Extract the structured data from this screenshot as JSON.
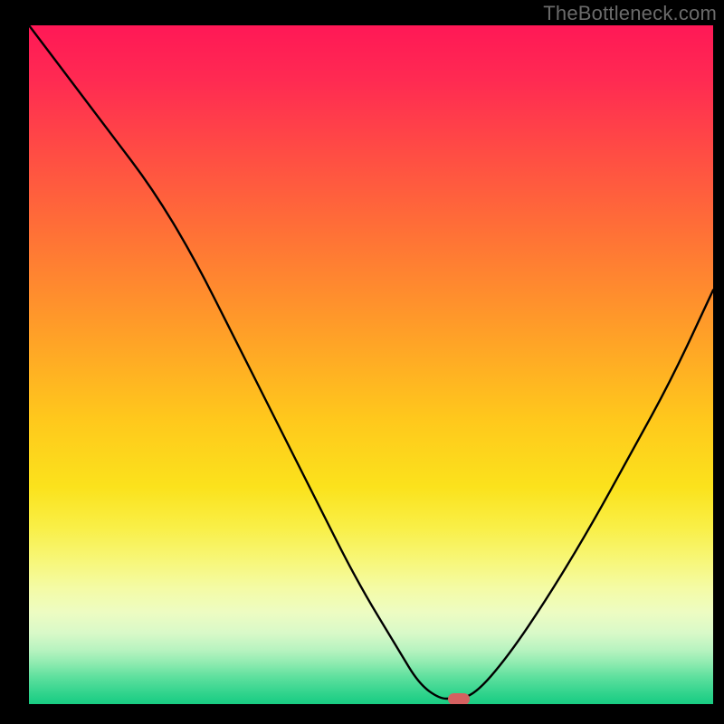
{
  "watermark": "TheBottleneck.com",
  "marker": {
    "cx_pct": 62.8,
    "cy_pct": 99.2
  },
  "chart_data": {
    "type": "line",
    "title": "",
    "xlabel": "",
    "ylabel": "",
    "xlim": [
      0,
      100
    ],
    "ylim": [
      0,
      100
    ],
    "grid": false,
    "legend": false,
    "background": "red-to-green vertical gradient",
    "note": "Axes are unlabeled; values estimated as percent of plot dimensions. y=0 is bottom (green), y=100 is top (red). Curve is a V-shaped line reaching the bottom near x≈60–65, with a small flat plateau at the bottom and a red pill marker at the minimum.",
    "series": [
      {
        "name": "bottleneck-curve",
        "x": [
          0,
          6,
          12,
          18,
          24,
          30,
          36,
          42,
          48,
          54,
          57,
          60,
          62,
          65,
          70,
          76,
          82,
          88,
          94,
          100
        ],
        "y": [
          100,
          92,
          84,
          76,
          66,
          54,
          42,
          30,
          18,
          8,
          3,
          0.8,
          0.8,
          1.2,
          7,
          16,
          26,
          37,
          48,
          61
        ]
      }
    ],
    "marker": {
      "x_pct": 62.8,
      "y_pct": 0.8,
      "shape": "pill",
      "color": "#d56060"
    },
    "gradient_stops": [
      {
        "pct": 0,
        "color": "#ff1856"
      },
      {
        "pct": 18,
        "color": "#ff4a45"
      },
      {
        "pct": 44,
        "color": "#ff9b29"
      },
      {
        "pct": 68,
        "color": "#fbe21c"
      },
      {
        "pct": 83,
        "color": "#f4fba6"
      },
      {
        "pct": 92,
        "color": "#b8f3c0"
      },
      {
        "pct": 100,
        "color": "#18cc82"
      }
    ]
  }
}
